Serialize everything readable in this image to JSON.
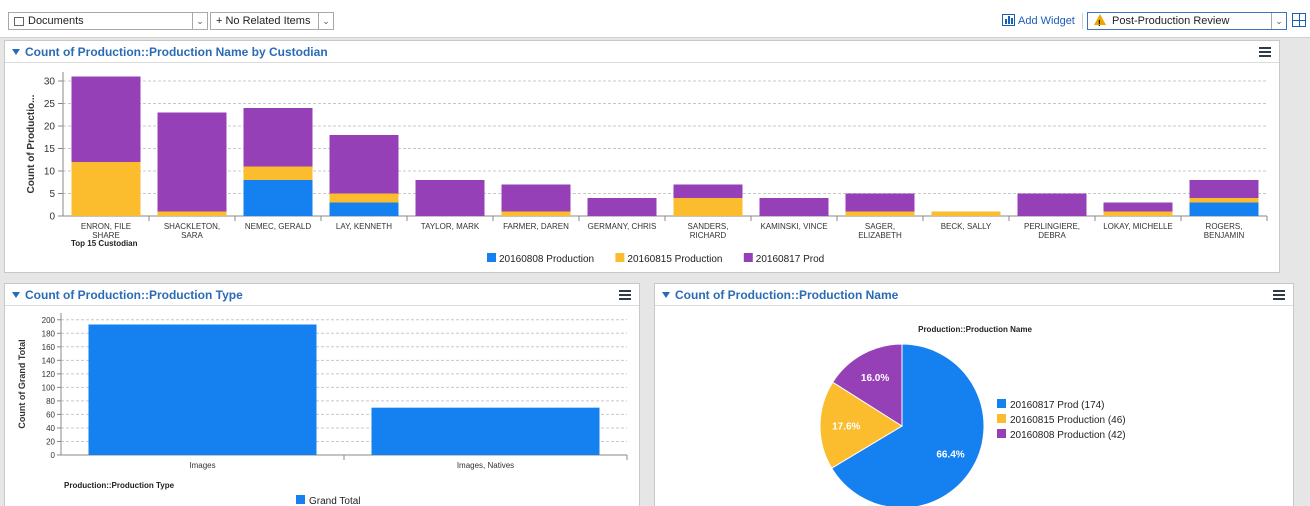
{
  "toolbar": {
    "documents_label": "Documents",
    "related_label": "+ No Related Items",
    "add_widget_label": "Add Widget",
    "view_label": "Post-Production Review"
  },
  "panels": {
    "custodian": {
      "title": "Count of Production::Production Name by Custodian"
    },
    "type": {
      "title": "Count of Production::Production Type"
    },
    "name": {
      "title": "Count of Production::Production Name"
    }
  },
  "colors": {
    "blue": "#1581f0",
    "orange": "#fbbc2e",
    "purple": "#9540b6",
    "accent": "#2a6bb5"
  },
  "chart_data": [
    {
      "type": "bar",
      "stacked": true,
      "title": "",
      "xlabel": "Top 15 Custodian",
      "ylabel": "Count of Productio...",
      "ylim": [
        0,
        32
      ],
      "yticks": [
        0,
        5,
        10,
        15,
        20,
        25,
        30
      ],
      "grid": true,
      "legend": "bottom",
      "categories": [
        [
          "ENRON, FILE",
          "SHARE"
        ],
        [
          "SHACKLETON,",
          "SARA"
        ],
        [
          "NEMEC, GERALD"
        ],
        [
          "LAY, KENNETH"
        ],
        [
          "TAYLOR, MARK"
        ],
        [
          "FARMER, DAREN"
        ],
        [
          "GERMANY, CHRIS"
        ],
        [
          "SANDERS,",
          "RICHARD"
        ],
        [
          "KAMINSKI, VINCE"
        ],
        [
          "SAGER,",
          "ELIZABETH"
        ],
        [
          "BECK, SALLY"
        ],
        [
          "PERLINGIERE,",
          "DEBRA"
        ],
        [
          "LOKAY, MICHELLE"
        ],
        [
          "ROGERS,",
          "BENJAMIN"
        ]
      ],
      "series": [
        {
          "name": "20160808 Production",
          "color": "#1581f0",
          "values": [
            0,
            0,
            8,
            3,
            0,
            0,
            0,
            0,
            0,
            0,
            0,
            0,
            0,
            3
          ]
        },
        {
          "name": "20160815 Production",
          "color": "#fbbc2e",
          "values": [
            12,
            1,
            3,
            2,
            0,
            1,
            0,
            4,
            0,
            1,
            1,
            0,
            1,
            1
          ]
        },
        {
          "name": "20160817 Prod",
          "color": "#9540b6",
          "values": [
            19,
            22,
            13,
            13,
            8,
            6,
            4,
            3,
            4,
            4,
            0,
            5,
            2,
            4
          ]
        }
      ]
    },
    {
      "type": "bar",
      "title": "",
      "xlabel": "Production::Production Type",
      "ylabel": "Count of Grand Total",
      "ylim": [
        0,
        210
      ],
      "yticks": [
        0,
        20,
        40,
        60,
        80,
        100,
        120,
        140,
        160,
        180,
        200
      ],
      "grid": true,
      "legend": "bottom",
      "categories": [
        "Images",
        "Images, Natives"
      ],
      "series": [
        {
          "name": "Grand Total",
          "color": "#1581f0",
          "values": [
            193,
            70
          ]
        }
      ]
    },
    {
      "type": "pie",
      "title": "Production::Production Name",
      "legend": "right",
      "slices": [
        {
          "label": "20160817 Prod (174)",
          "value": 174,
          "percent": "66.4%",
          "color": "#1581f0"
        },
        {
          "label": "20160815 Production (46)",
          "value": 46,
          "percent": "17.6%",
          "color": "#fbbc2e"
        },
        {
          "label": "20160808 Production (42)",
          "value": 42,
          "percent": "16.0%",
          "color": "#9540b6"
        }
      ]
    }
  ]
}
